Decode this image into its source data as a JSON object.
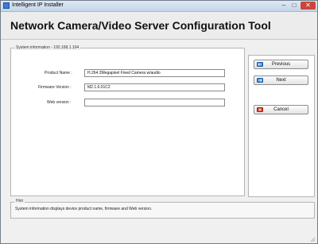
{
  "window": {
    "title": "Intelligent IP Installer",
    "minimize_glyph": "–",
    "maximize_glyph": "□",
    "close_glyph": "✕"
  },
  "header": {
    "title": "Network Camera/Video Server Configuration Tool"
  },
  "system_info": {
    "group_label": "System information - 192.168.1.104",
    "fields": [
      {
        "label": "Product Name :",
        "value": "H.264 2Megapixel Fixed Camera w/audio"
      },
      {
        "label": "Firmware Version :",
        "value": "M2.1.6.01C2"
      },
      {
        "label": "Web version :",
        "value": ""
      }
    ]
  },
  "buttons": {
    "previous": {
      "label": "Previous",
      "icon": "arrow-left-icon"
    },
    "next": {
      "label": "Next",
      "icon": "arrow-right-icon"
    },
    "cancel": {
      "label": "Cancel",
      "icon": "cancel-x-icon"
    }
  },
  "hint": {
    "label": "Hint",
    "text": "System information displays device product name, firmware and Web version."
  },
  "colors": {
    "close_button": "#c9463d",
    "arrow_icon": "#3b8be0",
    "cancel_icon": "#d93a2e"
  }
}
